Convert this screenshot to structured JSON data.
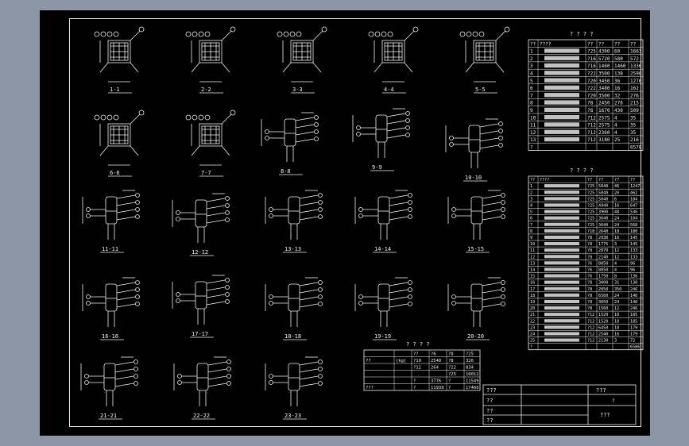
{
  "title_block": {
    "row1": "???",
    "row1_right": "???",
    "row2": "??",
    "row2_val": "?",
    "row3": "??",
    "row4": "??",
    "sheet_name": "???"
  },
  "sections": [
    "1-1",
    "2-2",
    "3-3",
    "4-4",
    "5-5",
    "6-6",
    "7-7",
    "8-8",
    "9-9",
    "10-10",
    "11-11",
    "12-12",
    "13-13",
    "14-14",
    "15-15",
    "16-16",
    "17-17",
    "18-18",
    "19-19",
    "20-20",
    "21-21",
    "22-22",
    "23-23"
  ],
  "table1": {
    "title": "? ? ? ?",
    "headers": [
      "??",
      "????",
      "??",
      "??",
      "??",
      "??"
    ],
    "rows": [
      [
        "1",
        "",
        "?25",
        "4300",
        "60",
        "1663"
      ],
      [
        "2",
        "",
        "?16",
        "5720",
        "580",
        "572"
      ],
      [
        "3",
        "",
        "?16",
        "1460",
        "1460",
        "1336"
      ],
      [
        "4",
        "",
        "?22",
        "3500",
        "138",
        "2590"
      ],
      [
        "5",
        "",
        "?20",
        "3450",
        "36",
        "1276"
      ],
      [
        "6",
        "",
        "?22",
        "3480",
        "16",
        "162"
      ],
      [
        "7",
        "",
        "?20",
        "3500",
        "32",
        "276"
      ],
      [
        "8",
        "",
        "?8",
        "2450",
        "276",
        "215"
      ],
      [
        "9",
        "",
        "?8",
        "1670",
        "430",
        "509"
      ],
      [
        "10",
        "",
        "?12",
        "2575",
        "4",
        "35"
      ],
      [
        "11",
        "",
        "?12",
        "2575",
        "4",
        "35"
      ],
      [
        "12",
        "",
        "?12",
        "2360",
        "4",
        "35"
      ],
      [
        "13",
        "",
        "?12",
        "3180",
        "25",
        "216"
      ],
      [
        "?",
        "",
        "",
        "",
        "",
        "6578"
      ]
    ]
  },
  "table2": {
    "title": "? ? ? ?",
    "headers": [
      "??",
      "????",
      "??",
      "??",
      "??",
      "??"
    ],
    "rows": [
      [
        "1",
        "",
        "?25",
        "5040",
        "46",
        "1247"
      ],
      [
        "2",
        "",
        "?25",
        "5040",
        "20",
        "462"
      ],
      [
        "3",
        "",
        "?25",
        "5040",
        "6",
        "184"
      ],
      [
        "4",
        "",
        "?25",
        "4940",
        "16",
        "647"
      ],
      [
        "5",
        "",
        "?25",
        "3900",
        "48",
        "536"
      ],
      [
        "6",
        "",
        "?25",
        "3640",
        "24",
        "104"
      ],
      [
        "7",
        "",
        "?25",
        "3640",
        "24",
        "568"
      ],
      [
        "8",
        "",
        "?18",
        "2640",
        "18",
        "180"
      ],
      [
        "9",
        "",
        "?8",
        "2930",
        "16",
        "145"
      ],
      [
        "10",
        "",
        "?8",
        "1775",
        "3",
        "145"
      ],
      [
        "11",
        "",
        "?8",
        "2870",
        "12",
        "133"
      ],
      [
        "12",
        "",
        "?8",
        "2140",
        "12",
        "133"
      ],
      [
        "13",
        "",
        "?6",
        "8050",
        "4",
        "96"
      ],
      [
        "14",
        "",
        "?6",
        "8050",
        "4",
        "96"
      ],
      [
        "15",
        "",
        "?6",
        "1750",
        "8",
        "136"
      ],
      [
        "16",
        "",
        "?8",
        "3000",
        "31",
        "138"
      ],
      [
        "17",
        "",
        "?8",
        "2050",
        "350",
        "246"
      ],
      [
        "18",
        "",
        "?8",
        "6560",
        "24",
        "140"
      ],
      [
        "19",
        "",
        "?8",
        "3050",
        "24",
        "140"
      ],
      [
        "20",
        "",
        "?8",
        "1560",
        "12",
        "246"
      ],
      [
        "21",
        "",
        "?12",
        "1520",
        "18",
        "185"
      ],
      [
        "22",
        "",
        "?12",
        "1520",
        "18",
        "185"
      ],
      [
        "23",
        "",
        "?12",
        "6450",
        "18",
        "179"
      ],
      [
        "24",
        "",
        "?12",
        "2540",
        "16",
        "179"
      ],
      [
        "25",
        "",
        "?12",
        "2130",
        "3",
        "72"
      ],
      [
        "?",
        "",
        "",
        "",
        "",
        "6586"
      ]
    ]
  },
  "table3": {
    "title": "? ? ? ?",
    "rows": [
      [
        "",
        "",
        "??",
        "?6",
        "?8",
        "?25"
      ],
      [
        "??",
        "(kg)",
        "?10",
        "2540",
        "?8",
        "326"
      ],
      [
        "",
        "",
        "?12",
        "264",
        "?22",
        "834"
      ],
      [
        "",
        "",
        "",
        "",
        "?25",
        "10012"
      ],
      [
        "",
        "",
        "?",
        "3776",
        "?",
        "11549"
      ],
      [
        "???",
        "",
        "?",
        "11939",
        "?",
        "17466"
      ]
    ]
  },
  "colors": {
    "line": "#f2f2f2",
    "background": "#000000",
    "surround": "#8c96a6"
  }
}
